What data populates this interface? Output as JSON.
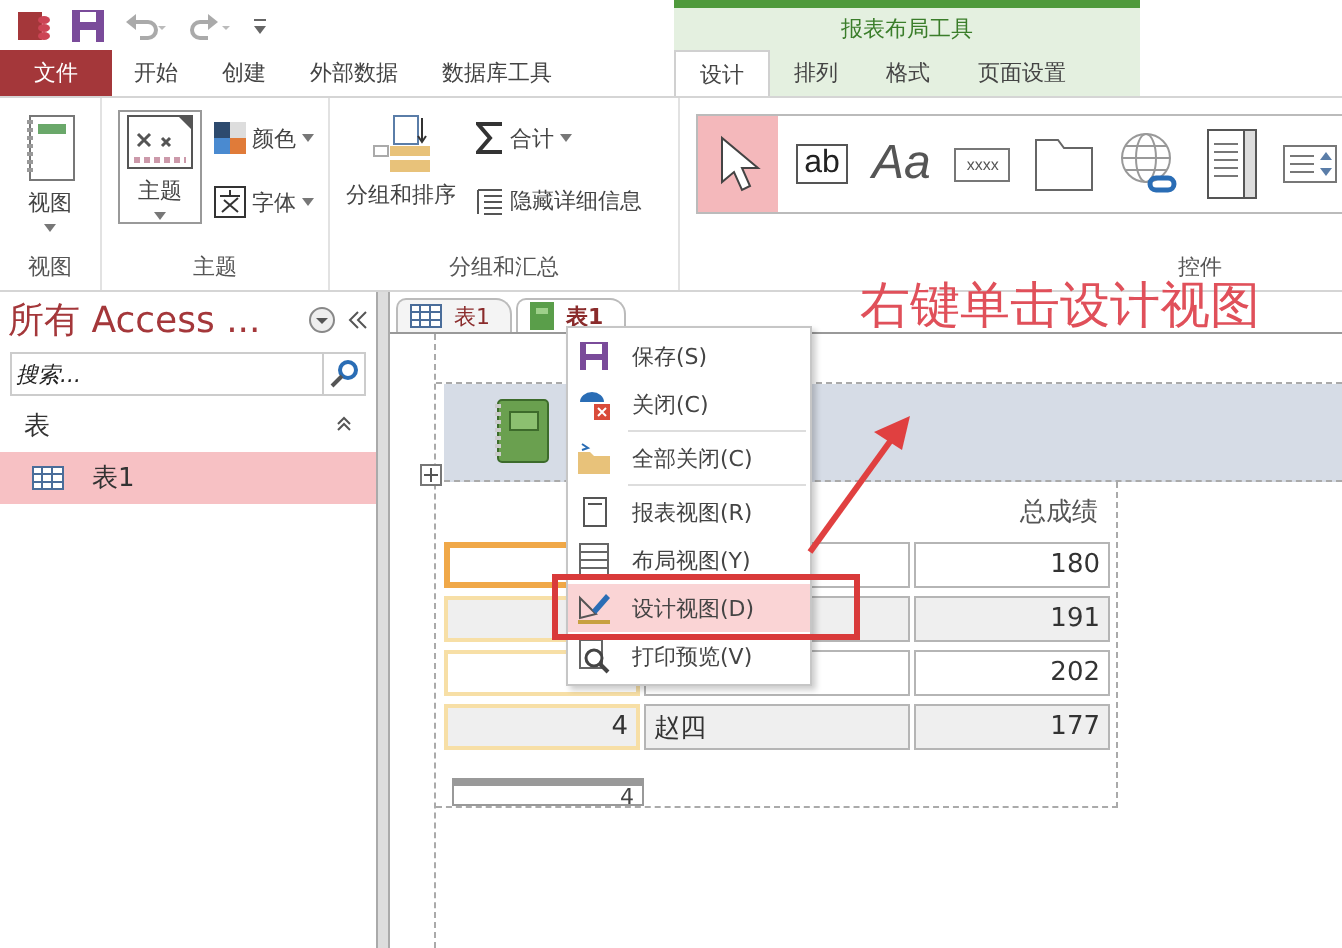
{
  "ribbon_tabs": [
    {
      "label": "文件",
      "kind": "file",
      "selected": false
    },
    {
      "label": "开始",
      "kind": "tab",
      "selected": false
    },
    {
      "label": "创建",
      "kind": "tab",
      "selected": false
    },
    {
      "label": "外部数据",
      "kind": "tab",
      "selected": false
    },
    {
      "label": "数据库工具",
      "kind": "tab",
      "selected": false
    }
  ],
  "contextual": {
    "title": "报表布局工具",
    "tabs": [
      {
        "label": "设计",
        "selected": true
      },
      {
        "label": "排列",
        "selected": false
      },
      {
        "label": "格式",
        "selected": false
      },
      {
        "label": "页面设置",
        "selected": false
      }
    ]
  },
  "ribbon": {
    "view_group": {
      "label": "视图",
      "button": "视图"
    },
    "theme_group": {
      "label": "主题",
      "theme_button": "主题",
      "colors": "颜色",
      "fonts": "字体"
    },
    "grouping_group": {
      "label": "分组和汇总",
      "group_sort": "分组和排序",
      "totals": "合计",
      "hide_details": "隐藏详细信息"
    },
    "controls_group": {
      "label": "控件",
      "controls": [
        {
          "kind": "select",
          "selected": true
        },
        {
          "kind": "textbox",
          "label": "ab",
          "selected": false
        },
        {
          "kind": "label",
          "label": "Aa",
          "selected": false
        },
        {
          "kind": "button",
          "label": "xxxx",
          "selected": false
        },
        {
          "kind": "tabcontrol",
          "selected": false
        },
        {
          "kind": "hyperlink",
          "selected": false
        },
        {
          "kind": "listbox",
          "selected": false
        },
        {
          "kind": "combo",
          "selected": false
        }
      ]
    }
  },
  "nav_pane": {
    "title": "所有 Access ...",
    "search_placeholder": "搜索...",
    "group": {
      "label": "表",
      "expanded": true,
      "items": [
        {
          "label": "表1",
          "selected": true
        }
      ]
    }
  },
  "doc_tabs": [
    {
      "label": "表1",
      "kind": "table",
      "selected": false
    },
    {
      "label": "表1",
      "kind": "report",
      "selected": true
    }
  ],
  "report": {
    "column_header": "总成绩",
    "rows": [
      {
        "score": "180",
        "selected": true
      },
      {
        "score": "191",
        "selected": false
      },
      {
        "score": "202",
        "selected": false
      },
      {
        "id": "4",
        "name": "赵四",
        "score": "177",
        "selected": false
      }
    ],
    "footer_count": "4"
  },
  "context_menu": {
    "groups": [
      [
        {
          "label": "保存(S)",
          "kind": "save",
          "selected": false
        },
        {
          "label": "关闭(C)",
          "kind": "close",
          "selected": false
        }
      ],
      [
        {
          "label": "全部关闭(C)",
          "kind": "closeall",
          "selected": false
        }
      ],
      [
        {
          "label": "报表视图(R)",
          "kind": "reportview",
          "selected": false
        },
        {
          "label": "布局视图(Y)",
          "kind": "layoutview",
          "selected": false
        },
        {
          "label": "设计视图(D)",
          "kind": "designview",
          "selected": true
        },
        {
          "label": "打印预览(V)",
          "kind": "preview",
          "selected": false
        }
      ]
    ]
  },
  "annotation": {
    "text": "右键单击设计视图"
  }
}
